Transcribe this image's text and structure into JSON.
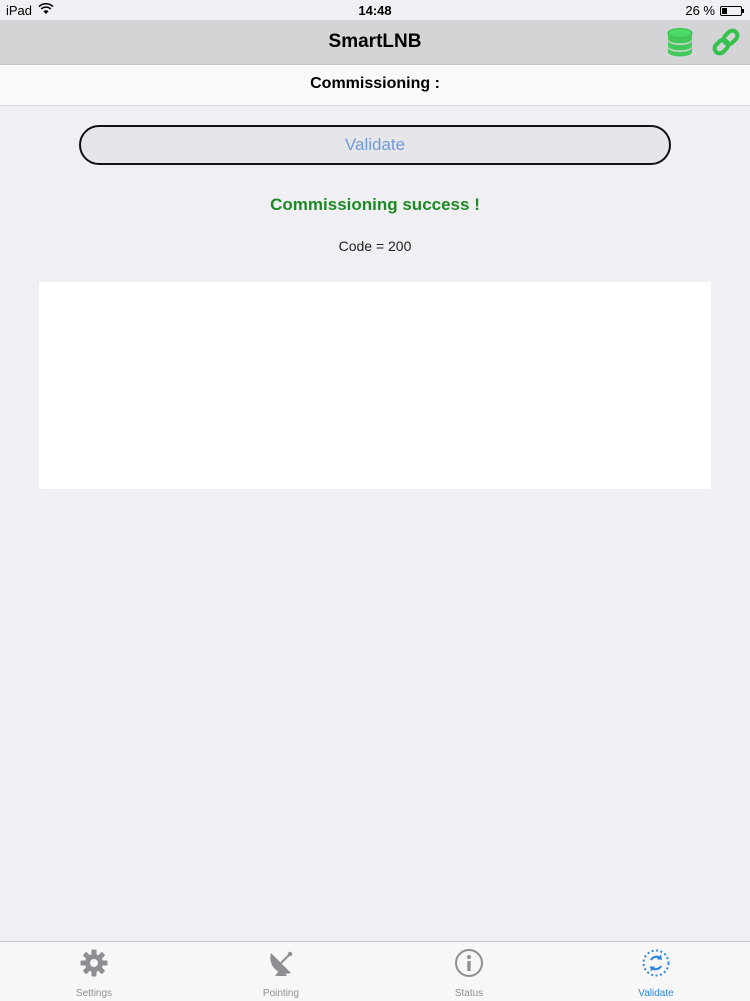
{
  "status_bar": {
    "device": "iPad",
    "time": "14:48",
    "battery": "26 %",
    "battery_level": 0.26
  },
  "nav": {
    "title": "SmartLNB",
    "icons": [
      "database-icon",
      "link-icon"
    ]
  },
  "section": {
    "title": "Commissioning :"
  },
  "validate": {
    "label": "Validate"
  },
  "result": {
    "message": "Commissioning success !",
    "code": "Code = 200"
  },
  "tabs": [
    {
      "label": "Settings",
      "icon": "gear-icon",
      "active": false
    },
    {
      "label": "Pointing",
      "icon": "satellite-dish-icon",
      "active": false
    },
    {
      "label": "Status",
      "icon": "info-icon",
      "active": false
    },
    {
      "label": "Validate",
      "icon": "validate-icon",
      "active": true
    }
  ],
  "colors": {
    "success": "#1e8a23",
    "accent": "#2e86de",
    "button_text": "#6f9bd9",
    "db_icon": "#4cd964"
  }
}
